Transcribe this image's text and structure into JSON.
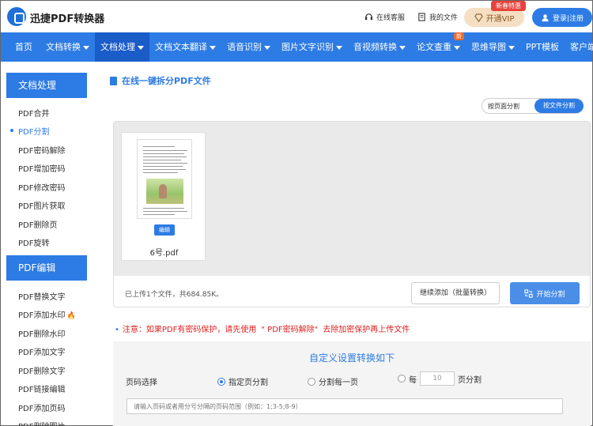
{
  "header": {
    "brand": "迅捷PDF转换器",
    "service_label": "在线客服",
    "myfiles_label": "我的文件",
    "vip_badge": "新春特惠",
    "vip_label": "开通VIP",
    "login_label": "登录|注册"
  },
  "nav": {
    "items": [
      {
        "label": "首页"
      },
      {
        "label": "文档转换"
      },
      {
        "label": "文档处理"
      },
      {
        "label": "文档文本翻译"
      },
      {
        "label": "语音识别"
      },
      {
        "label": "图片文字识别"
      },
      {
        "label": "音视频转换"
      },
      {
        "label": "论文查重"
      },
      {
        "label": "思维导图"
      },
      {
        "label": "PPT模板"
      },
      {
        "label": "客户端"
      }
    ],
    "new_badge": "新"
  },
  "sidebar": {
    "section1": "文档处理",
    "items1": [
      "PDF合并",
      "PDF分割",
      "PDF密码解除",
      "PDF增加密码",
      "PDF修改密码",
      "PDF图片获取",
      "PDF删除页",
      "PDF旋转"
    ],
    "section2": "PDF编辑",
    "items2": [
      "PDF替换文字",
      "PDF添加水印",
      "PDF删除水印",
      "PDF添加文字",
      "PDF删除文字",
      "PDF链接编辑",
      "PDF添加页码",
      "PDF删除图片"
    ]
  },
  "main": {
    "title": "在线一键拆分PDF文件",
    "mode_page": "按页面分割",
    "mode_file": "按文件分割",
    "file": {
      "name": "6号.pdf",
      "edit_label": "编辑"
    },
    "status": "已上传1个文件，共684.85K。",
    "add_button": "继续添加（批量转换）",
    "start_button": "开始分割"
  },
  "notice": {
    "prefix": "注意：如果PDF有密码保护，请先使用",
    "link": "\" PDF密码解除\"",
    "suffix": "去除加密保护再上传文件"
  },
  "settings": {
    "title": "自定义设置转换如下",
    "label": "页码选择",
    "option1": "指定页分割",
    "option2": "分割每一页",
    "option3_prefix": "每",
    "option3_value": "10",
    "option3_suffix": "页分割",
    "range_placeholder": "请输入页码或者用分号分隔的页码范围（例如：1;3-5;8-9）"
  }
}
